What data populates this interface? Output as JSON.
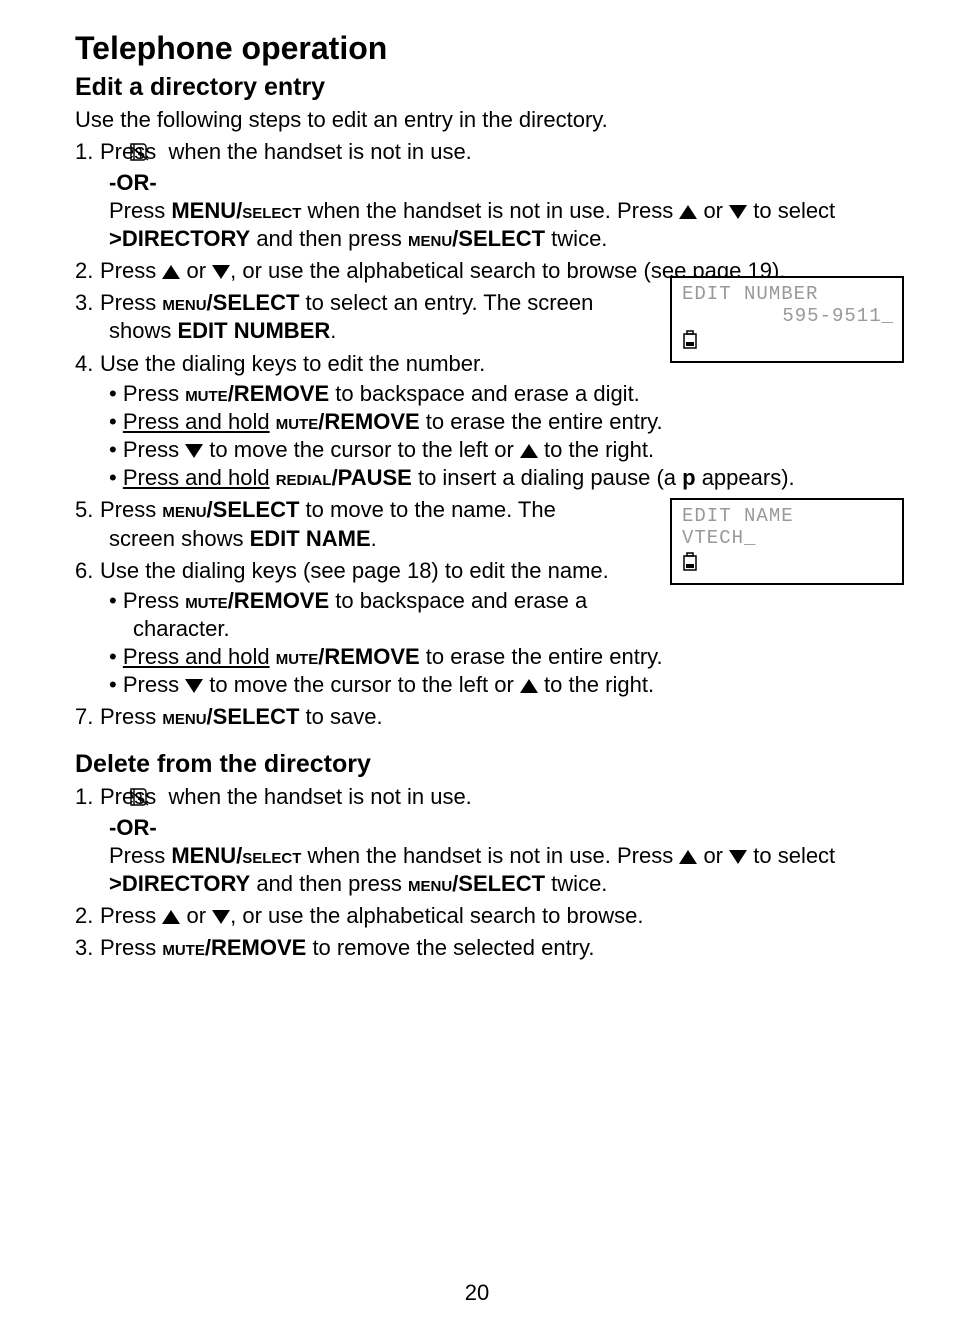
{
  "title": "Telephone operation",
  "section_edit": {
    "heading": "Edit a directory entry",
    "intro": "Use the following steps to edit an entry in the directory.",
    "step1_a": "Press ",
    "step1_b": " when the handset is not in use.",
    "or": "-OR-",
    "step1_c1": "Press ",
    "step1_c2": "MENU/",
    "step1_c3": "select",
    "step1_c4": " when the handset is not in use. Press ",
    "step1_c5": " or ",
    "step1_c6": "  to ",
    "step1_c7": "select ",
    "step1_c8": ">DIRECTORY",
    "step1_c9": " and then press ",
    "step1_c10": "menu",
    "step1_c11": "/SELECT",
    "step1_c12": " twice.",
    "step2_a": "Press ",
    "step2_b": " or ",
    "step2_c": ", or use the alphabetical search to browse (see page 19).",
    "step3_a": "Press ",
    "step3_b": "menu",
    "step3_c": "/SELECT",
    "step3_d": " to select an entry. The screen shows ",
    "step3_e": "EDIT NUMBER",
    "step3_f": ".",
    "step4_a": "Use the dialing keys to edit the number.",
    "step4_b1_a": "Press ",
    "step4_b1_b": "mute",
    "step4_b1_c": "/REMOVE",
    "step4_b1_d": " to backspace and erase a digit.",
    "step4_b2_a": "Press and hold",
    "step4_b2_b": " ",
    "step4_b2_c": "mute",
    "step4_b2_d": "/REMOVE",
    "step4_b2_e": " to erase the entire entry.",
    "step4_b3_a": "Press ",
    "step4_b3_b": " to move the cursor to the left or ",
    "step4_b3_c": " to the right.",
    "step4_b4_a": "Press and hold",
    "step4_b4_b": " ",
    "step4_b4_c": "redial",
    "step4_b4_d": "/PAUSE",
    "step4_b4_e": " to insert a dialing pause (a ",
    "step4_b4_f": "p",
    "step4_b4_g": " appears).",
    "step5_a": "Press ",
    "step5_b": "menu",
    "step5_c": "/SELECT",
    "step5_d": " to move to the name. The screen shows ",
    "step5_e": "EDIT NAME",
    "step5_f": ".",
    "step6_a": "Use the dialing keys (see page 18) to edit the name.",
    "step6_b1_a": "Press ",
    "step6_b1_b": "mute",
    "step6_b1_c": "/REMOVE",
    "step6_b1_d": " to backspace and erase a character.",
    "step6_b2_a": "Press and hold",
    "step6_b2_b": " ",
    "step6_b2_c": "mute",
    "step6_b2_d": "/REMOVE",
    "step6_b2_e": " to erase the entire entry.",
    "step6_b3_a": "Press ",
    "step6_b3_b": " to move the cursor to the left or ",
    "step6_b3_c": " to the right.",
    "step7_a": "Press ",
    "step7_b": "menu",
    "step7_c": "/SELECT",
    "step7_d": " to save."
  },
  "section_delete": {
    "heading": "Delete from the directory",
    "step1_a": "Press ",
    "step1_b": " when the handset is not in use.",
    "or": "-OR-",
    "step1_c1": "Press ",
    "step1_c2": "MENU/",
    "step1_c3": "select",
    "step1_c4": " when the handset is not in use. Press ",
    "step1_c5": " or ",
    "step1_c6": "  to ",
    "step1_c7": "select ",
    "step1_c8": ">DIRECTORY",
    "step1_c9": " and then press ",
    "step1_c10": "menu",
    "step1_c11": "/SELECT",
    "step1_c12": " twice.",
    "step2_a": "Press ",
    "step2_b": " or ",
    "step2_c": ", or use the alphabetical search to browse.",
    "step3_a": "Press ",
    "step3_b": "mute",
    "step3_c": "/REMOVE",
    "step3_d": " to remove the selected entry."
  },
  "screen1": {
    "line1": "EDIT NUMBER",
    "line2": "595-9511_"
  },
  "screen2": {
    "line1": "EDIT NAME",
    "line2": "VTECH_"
  },
  "page_num": "20"
}
